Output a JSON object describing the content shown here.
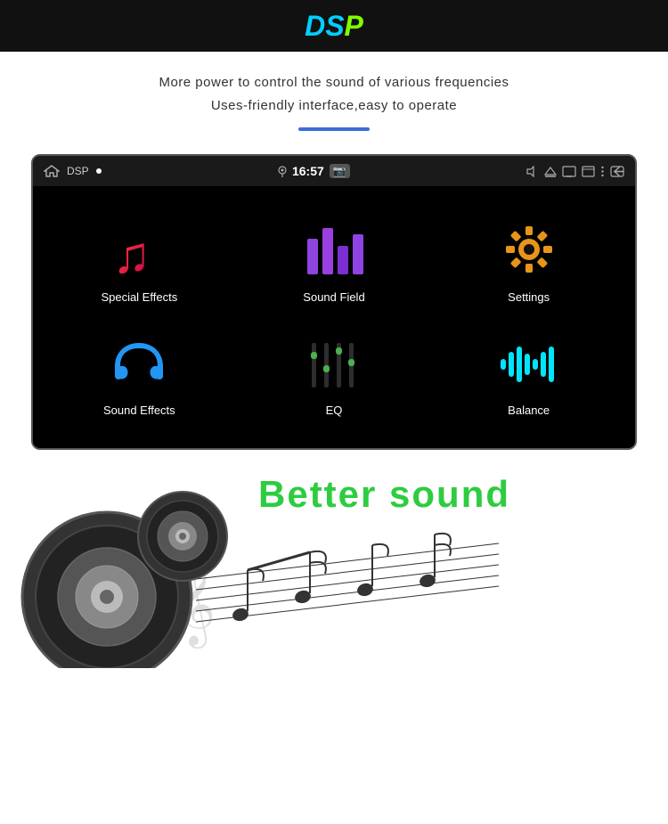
{
  "header": {
    "title_part1": "D",
    "title_part2": "S",
    "title_part3": "P",
    "full_title": "DSP"
  },
  "subtitle": {
    "line1": "More  power  to  control  the  sound  of  various  frequencies",
    "line2": "Uses-friendly  interface,easy  to  operate"
  },
  "status_bar": {
    "app_name": "DSP",
    "time": "16:57",
    "left_icons": [
      "home",
      "dot"
    ],
    "right_icons": [
      "location",
      "volume",
      "triangle",
      "screen",
      "window",
      "menu",
      "back"
    ]
  },
  "app_grid": {
    "items": [
      {
        "id": "special-effects",
        "label": "Special Effects"
      },
      {
        "id": "sound-field",
        "label": "Sound Field"
      },
      {
        "id": "settings",
        "label": "Settings"
      },
      {
        "id": "sound-effects",
        "label": "Sound Effects"
      },
      {
        "id": "eq",
        "label": "EQ"
      },
      {
        "id": "balance",
        "label": "Balance"
      }
    ]
  },
  "better_sound": {
    "title_line1": "Better  sound"
  }
}
